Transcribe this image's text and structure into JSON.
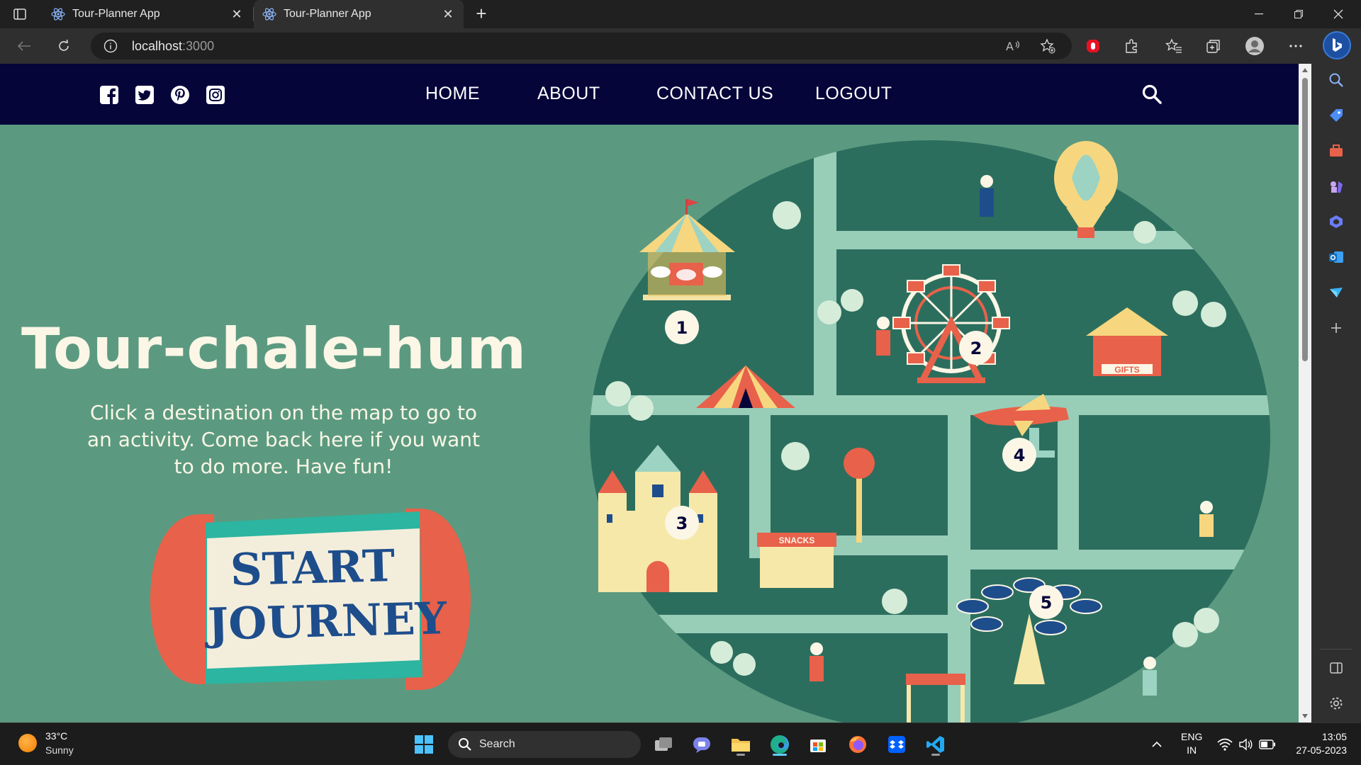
{
  "browser": {
    "tabs": [
      {
        "title": "Tour-Planner App",
        "active": false
      },
      {
        "title": "Tour-Planner App",
        "active": true
      }
    ],
    "address": {
      "host": "localhost",
      "port": ":3000"
    }
  },
  "site": {
    "nav": {
      "social": [
        "facebook-icon",
        "twitter-icon",
        "pinterest-icon",
        "instagram-icon"
      ],
      "links": {
        "home": "HOME",
        "about": "ABOUT",
        "contact": "CONTACT US",
        "logout": "LOGOUT"
      }
    },
    "hero": {
      "title": "Tour-chale-hum",
      "subtitle": "Click a destination on the map to go to an activity. Come back here if you want to do more. Have fun!",
      "cta_line1": "START",
      "cta_line2": "JOURNEY"
    },
    "map": {
      "destinations": [
        {
          "number": "1",
          "name": "carousel"
        },
        {
          "number": "2",
          "name": "ferris-wheel"
        },
        {
          "number": "3",
          "name": "castle"
        },
        {
          "number": "4",
          "name": "airplane-ride"
        },
        {
          "number": "5",
          "name": "swing-ride"
        }
      ],
      "signs": {
        "gifts": "GIFTS",
        "snacks": "SNACKS"
      }
    },
    "colors": {
      "nav_bg": "#05053a",
      "hero_bg": "#5b9a80",
      "map_bg": "#2c6e5e",
      "path": "#98cdb8",
      "cream": "#fbf6e6",
      "coral": "#e8614a",
      "teal": "#2cb5a0",
      "navy": "#1e4d8c"
    }
  },
  "taskbar": {
    "weather": {
      "temp": "33°C",
      "desc": "Sunny"
    },
    "search_label": "Search",
    "lang": {
      "line1": "ENG",
      "line2": "IN"
    },
    "clock": {
      "time": "13:05",
      "date": "27-05-2023"
    }
  }
}
